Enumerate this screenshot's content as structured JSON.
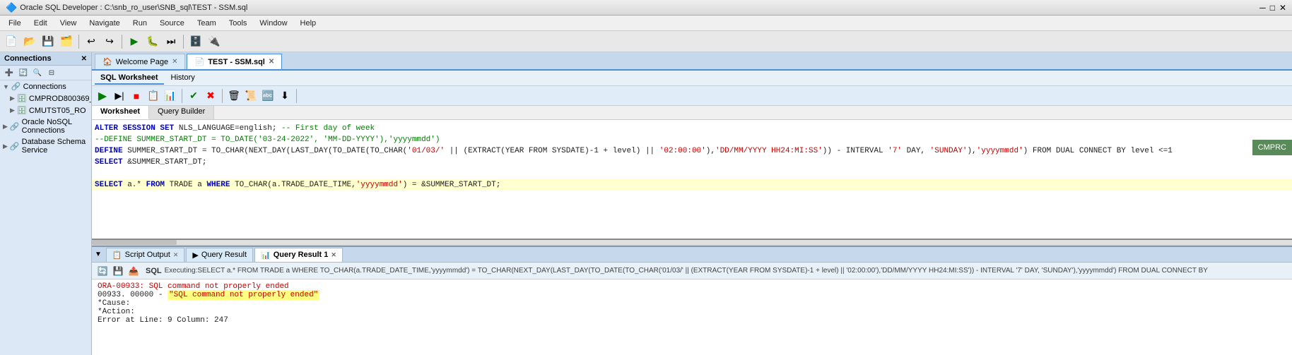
{
  "titlebar": {
    "text": "Oracle SQL Developer : C:\\snb_ro_user\\SNB_sql\\TEST - SSM.sql"
  },
  "menubar": {
    "items": [
      "File",
      "Edit",
      "View",
      "Navigate",
      "Run",
      "Source",
      "Team",
      "Tools",
      "Window",
      "Help"
    ]
  },
  "connections": {
    "header": "Connections",
    "items": [
      {
        "label": "Connections",
        "type": "root",
        "expanded": true
      },
      {
        "label": "CMPROD800369_RO",
        "type": "connection"
      },
      {
        "label": "CMUTST05_RO",
        "type": "connection"
      },
      {
        "label": "Oracle NoSQL Connections",
        "type": "group"
      },
      {
        "label": "Database Schema Service",
        "type": "group"
      }
    ]
  },
  "tabs": [
    {
      "label": "Welcome Page",
      "icon": "🏠",
      "active": false,
      "closable": true
    },
    {
      "label": "TEST - SSM.sql",
      "icon": "📄",
      "active": true,
      "closable": true
    }
  ],
  "worksheet_tabs": [
    "SQL Worksheet",
    "History"
  ],
  "editor_tabs": [
    "Worksheet",
    "Query Builder"
  ],
  "sql_code": [
    {
      "line": "",
      "content": "ALTER SESSION SET NLS_LANGUAGE=english; -- First day of week"
    },
    {
      "line": "",
      "content": "--DEFINE SUMMER_START_DT = TO_DATE('03-24-2022', 'MM-DD-YYYY'),'yyyymmdd')"
    },
    {
      "line": "",
      "content": "DEFINE SUMMER_START_DT = TO_CHAR(NEXT_DAY(LAST_DAY(TO_DATE(TO_CHAR('01/03/' || (EXTRACT(YEAR FROM SYSDATE)-1 + level) || '02:00:00'),'DD/MM/YYYY HH24:MI:SS')) - INTERVAL '7' DAY, 'SUNDAY'),'yyyymmdd') FROM DUAL CONNECT BY level <=1"
    },
    {
      "line": "",
      "content": "SELECT &SUMMER_START_DT;"
    },
    {
      "line": "",
      "content": ""
    },
    {
      "line": "",
      "content": "SELECT a.* FROM TRADE a WHERE TO_CHAR(a.TRADE_DATE_TIME,'yyyymmdd') = &SUMMER_START_DT;"
    }
  ],
  "bottom_tabs": [
    {
      "label": "Script Output",
      "active": false,
      "closable": true
    },
    {
      "label": "Query Result",
      "active": false,
      "closable": false,
      "icon": "▶"
    },
    {
      "label": "Query Result 1",
      "active": true,
      "closable": true,
      "icon": "📊"
    }
  ],
  "executing_sql_label": "SQL",
  "executing_sql_text": "Executing:SELECT a.* FROM TRADE a WHERE TO_CHAR(a.TRADE_DATE_TIME,'yyyymmdd') = TO_CHAR(NEXT_DAY(LAST_DAY(TO_DATE(TO_CHAR('01/03/' || (EXTRACT(YEAR FROM SYSDATE)-1 + level) || '02:00:00'),'DD/MM/YYYY HH24:MI:SS')) - INTERVAL '7' DAY, 'SUNDAY'),'yyyymmdd') FROM DUAL CONNECT BY",
  "script_output": {
    "line1": "ORA-00933: SQL command not properly ended",
    "line2": "00933. 00000 -",
    "line2_highlight": "\"SQL command not properly ended\"",
    "line3": "*Cause:",
    "line4": "*Action:",
    "line5": "Error at Line: 9 Column: 247"
  },
  "top_right": "CMPRC",
  "bottom_arrow_label": "▼"
}
